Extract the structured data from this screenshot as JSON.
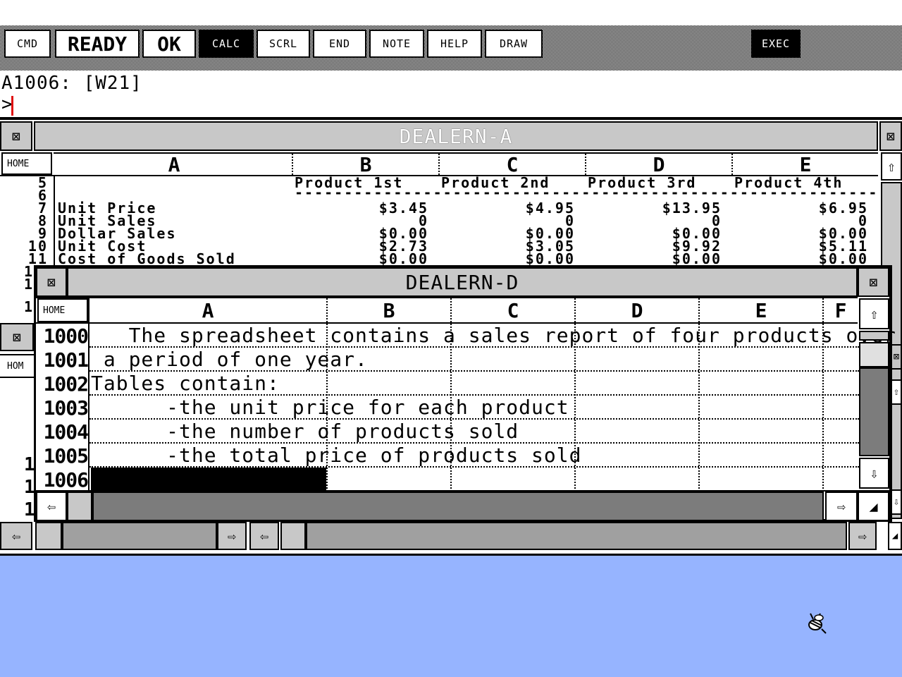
{
  "toolbar": {
    "cmd": "CMD",
    "ready": "READY",
    "ok": "OK",
    "calc": "CALC",
    "scrl": "SCRL",
    "end": "END",
    "note": "NOTE",
    "help": "HELP",
    "draw": "DRAW",
    "exec": "EXEC"
  },
  "cell_reference": "A1006: [W21]",
  "command_prompt": ">",
  "icons": {
    "close": "⊠",
    "home": "HOME",
    "up": "⇧",
    "down": "⇩",
    "left": "⇦",
    "right": "⇨",
    "size": "◢"
  },
  "window_a": {
    "title": "DEALERN-A",
    "columns": [
      "A",
      "B",
      "C",
      "D",
      "E"
    ],
    "product_headers": [
      "Product 1st",
      "Product 2nd",
      "Product 3rd",
      "Product 4th"
    ],
    "dash_line": "--------------------------------------------------------------------------",
    "rows": [
      {
        "num": "5",
        "label": "",
        "values": [
          "",
          "",
          "",
          ""
        ]
      },
      {
        "num": "6",
        "label": "",
        "values": [
          "",
          "",
          "",
          ""
        ]
      },
      {
        "num": "7",
        "label": "Unit Price",
        "values": [
          "$3.45",
          "$4.95",
          "$13.95",
          "$6.95"
        ]
      },
      {
        "num": "8",
        "label": "Unit Sales",
        "values": [
          "0",
          "0",
          "0",
          "0"
        ]
      },
      {
        "num": "9",
        "label": "Dollar Sales",
        "values": [
          "$0.00",
          "$0.00",
          "$0.00",
          "$0.00"
        ]
      },
      {
        "num": "10",
        "label": "Unit Cost",
        "values": [
          "$2.73",
          "$3.05",
          "$9.92",
          "$5.11"
        ]
      },
      {
        "num": "11",
        "label": "Cost of Goods Sold",
        "values": [
          "$0.00",
          "$0.00",
          "$0.00",
          "$0.00"
        ]
      }
    ],
    "hidden_row_nums": [
      "1",
      "1",
      "1",
      "1",
      "1",
      "1"
    ]
  },
  "window_d": {
    "title": "DEALERN-D",
    "columns": [
      "A",
      "B",
      "C",
      "D",
      "E",
      "F"
    ],
    "rows": [
      {
        "num": "1000",
        "text": "   The spreadsheet contains a sales report of four products over"
      },
      {
        "num": "1001",
        "text": " a period of one year."
      },
      {
        "num": "1002",
        "text": "Tables contain:"
      },
      {
        "num": "1003",
        "text": "      -the unit price for each product"
      },
      {
        "num": "1004",
        "text": "      -the number of products sold"
      },
      {
        "num": "1005",
        "text": "      -the total price of products sold"
      },
      {
        "num": "1006",
        "text": ""
      }
    ]
  },
  "partial_window": {
    "home_label": "HOM"
  }
}
